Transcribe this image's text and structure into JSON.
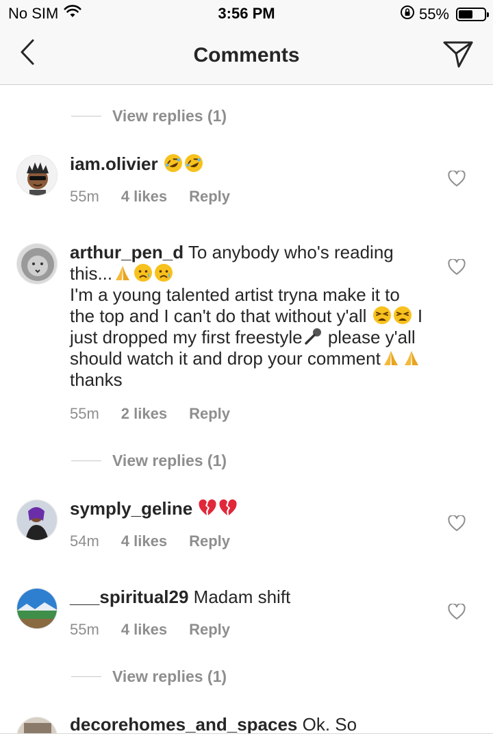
{
  "status_bar": {
    "carrier": "No SIM",
    "time": "3:56 PM",
    "battery_text": "55%",
    "battery_level": 0.55
  },
  "nav": {
    "title": "Comments",
    "back_icon": "chevron-left-icon",
    "direct_icon": "paper-plane-icon"
  },
  "view_replies_label": "View replies (1)",
  "comments": [
    {
      "username": "iam.olivier",
      "text": "",
      "emojis": [
        "rolling-on-floor-laughing",
        "rolling-on-floor-laughing"
      ],
      "time": "55m",
      "likes": "4 likes",
      "reply": "Reply"
    },
    {
      "username": "arthur_pen_d",
      "text_1": "To anybody who's reading this...",
      "emojis_1": [
        "folded-hands",
        "sad-but-relieved-face",
        "sad-but-relieved-face"
      ],
      "text_2": "I'm a young talented artist tryna make  it to the top and I can't do that without y'all",
      "emojis_2": [
        "tired-face",
        "tired-face"
      ],
      "text_3": "I just dropped my first freestyle",
      "emojis_3": [
        "microphone"
      ],
      "text_4": "please y'all should watch it and drop your comment",
      "emojis_4": [
        "folded-hands",
        "folded-hands"
      ],
      "text_5": "thanks",
      "time": "55m",
      "likes": "2 likes",
      "reply": "Reply"
    },
    {
      "username": "symply_geline",
      "text": "",
      "emojis": [
        "broken-heart",
        "broken-heart"
      ],
      "time": "54m",
      "likes": "4 likes",
      "reply": "Reply"
    },
    {
      "username": "___spiritual29",
      "text": "Madam shift",
      "time": "55m",
      "likes": "4 likes",
      "reply": "Reply"
    },
    {
      "username": "decorehomes_and_spaces",
      "text": "Ok. So"
    }
  ],
  "colors": {
    "text": "#262626",
    "secondary": "#8e8e8e",
    "bar_bg": "#f8f8f8",
    "heart_outline": "#8e8e8e"
  }
}
